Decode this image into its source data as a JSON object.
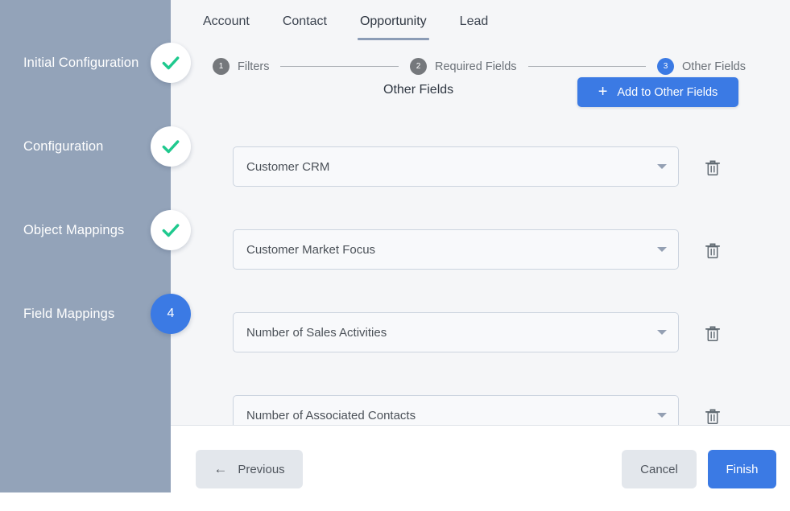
{
  "colors": {
    "sidebar_bg": "#93a3b9",
    "content_bg": "#f5f6f8",
    "accent_blue": "#3b7ae4",
    "check_green": "#1fc98e",
    "tab_underline": "#8b9cb6",
    "muted_button": "#e3e7ec"
  },
  "sidebar": {
    "steps": [
      {
        "label": "Initial Configuration",
        "state": "done",
        "badge": "check-icon"
      },
      {
        "label": "Configuration",
        "state": "done",
        "badge": "check-icon"
      },
      {
        "label": "Object Mappings",
        "state": "done",
        "badge": "check-icon"
      },
      {
        "label": "Field Mappings",
        "state": "active",
        "badge": "4"
      }
    ]
  },
  "tabs": [
    {
      "label": "Account",
      "active": false
    },
    {
      "label": "Contact",
      "active": false
    },
    {
      "label": "Opportunity",
      "active": true
    },
    {
      "label": "Lead",
      "active": false
    }
  ],
  "stepper": [
    {
      "num": "1",
      "label": "Filters",
      "current": false
    },
    {
      "num": "2",
      "label": "Required Fields",
      "current": false
    },
    {
      "num": "3",
      "label": "Other Fields",
      "current": true
    }
  ],
  "section": {
    "title": "Other Fields",
    "add_button_label": "Add to Other Fields",
    "add_button_icon": "plus-icon"
  },
  "fields": [
    {
      "value": "Customer CRM",
      "delete_icon": "trash-icon"
    },
    {
      "value": "Customer Market Focus",
      "delete_icon": "trash-icon"
    },
    {
      "value": "Number of Sales Activities",
      "delete_icon": "trash-icon"
    },
    {
      "value": "Number of Associated Contacts",
      "delete_icon": "trash-icon"
    }
  ],
  "footer": {
    "previous_label": "Previous",
    "previous_icon": "arrow-left-icon",
    "cancel_label": "Cancel",
    "finish_label": "Finish"
  }
}
